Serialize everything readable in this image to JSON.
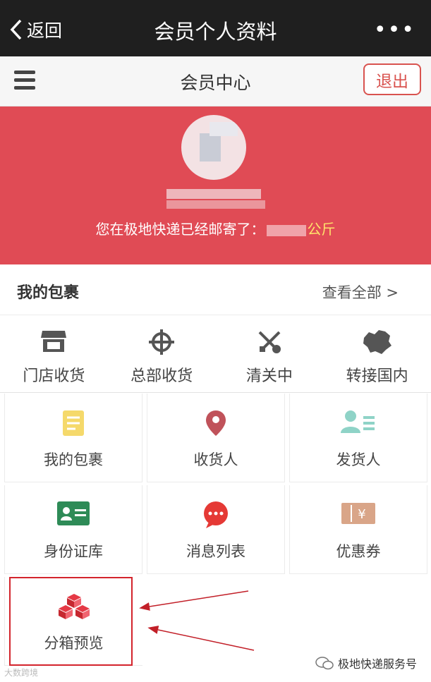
{
  "titlebar": {
    "back_label": "返回",
    "title": "会员个人资料",
    "more": "•••"
  },
  "header": {
    "title": "会员中心",
    "logout_label": "退出"
  },
  "hero": {
    "summary_prefix": "您在极地快递已经邮寄了：",
    "summary_unit": "公斤"
  },
  "packages": {
    "title": "我的包裹",
    "view_all": "查看全部 >",
    "statuses": [
      {
        "label": "门店收货",
        "icon": "store-icon"
      },
      {
        "label": "总部收货",
        "icon": "crosshair-icon"
      },
      {
        "label": "清关中",
        "icon": "tools-icon"
      },
      {
        "label": "转接国内",
        "icon": "china-map-icon"
      }
    ]
  },
  "menu": [
    {
      "label": "我的包裹",
      "icon": "notepad-icon",
      "color": "#f5d96b"
    },
    {
      "label": "收货人",
      "icon": "location-pin-icon",
      "color": "#c0525a"
    },
    {
      "label": "发货人",
      "icon": "contacts-icon",
      "color": "#8fd3c7"
    },
    {
      "label": "身份证库",
      "icon": "id-card-icon",
      "color": "#2e8b57"
    },
    {
      "label": "消息列表",
      "icon": "message-bubble-icon",
      "color": "#e53935"
    },
    {
      "label": "优惠券",
      "icon": "coupon-icon",
      "color": "#d9a588"
    },
    {
      "label": "分箱预览",
      "icon": "boxes-icon",
      "color": "#e53945"
    }
  ],
  "watermark_left": "大数跨境",
  "watermark_right": "极地快递服务号"
}
